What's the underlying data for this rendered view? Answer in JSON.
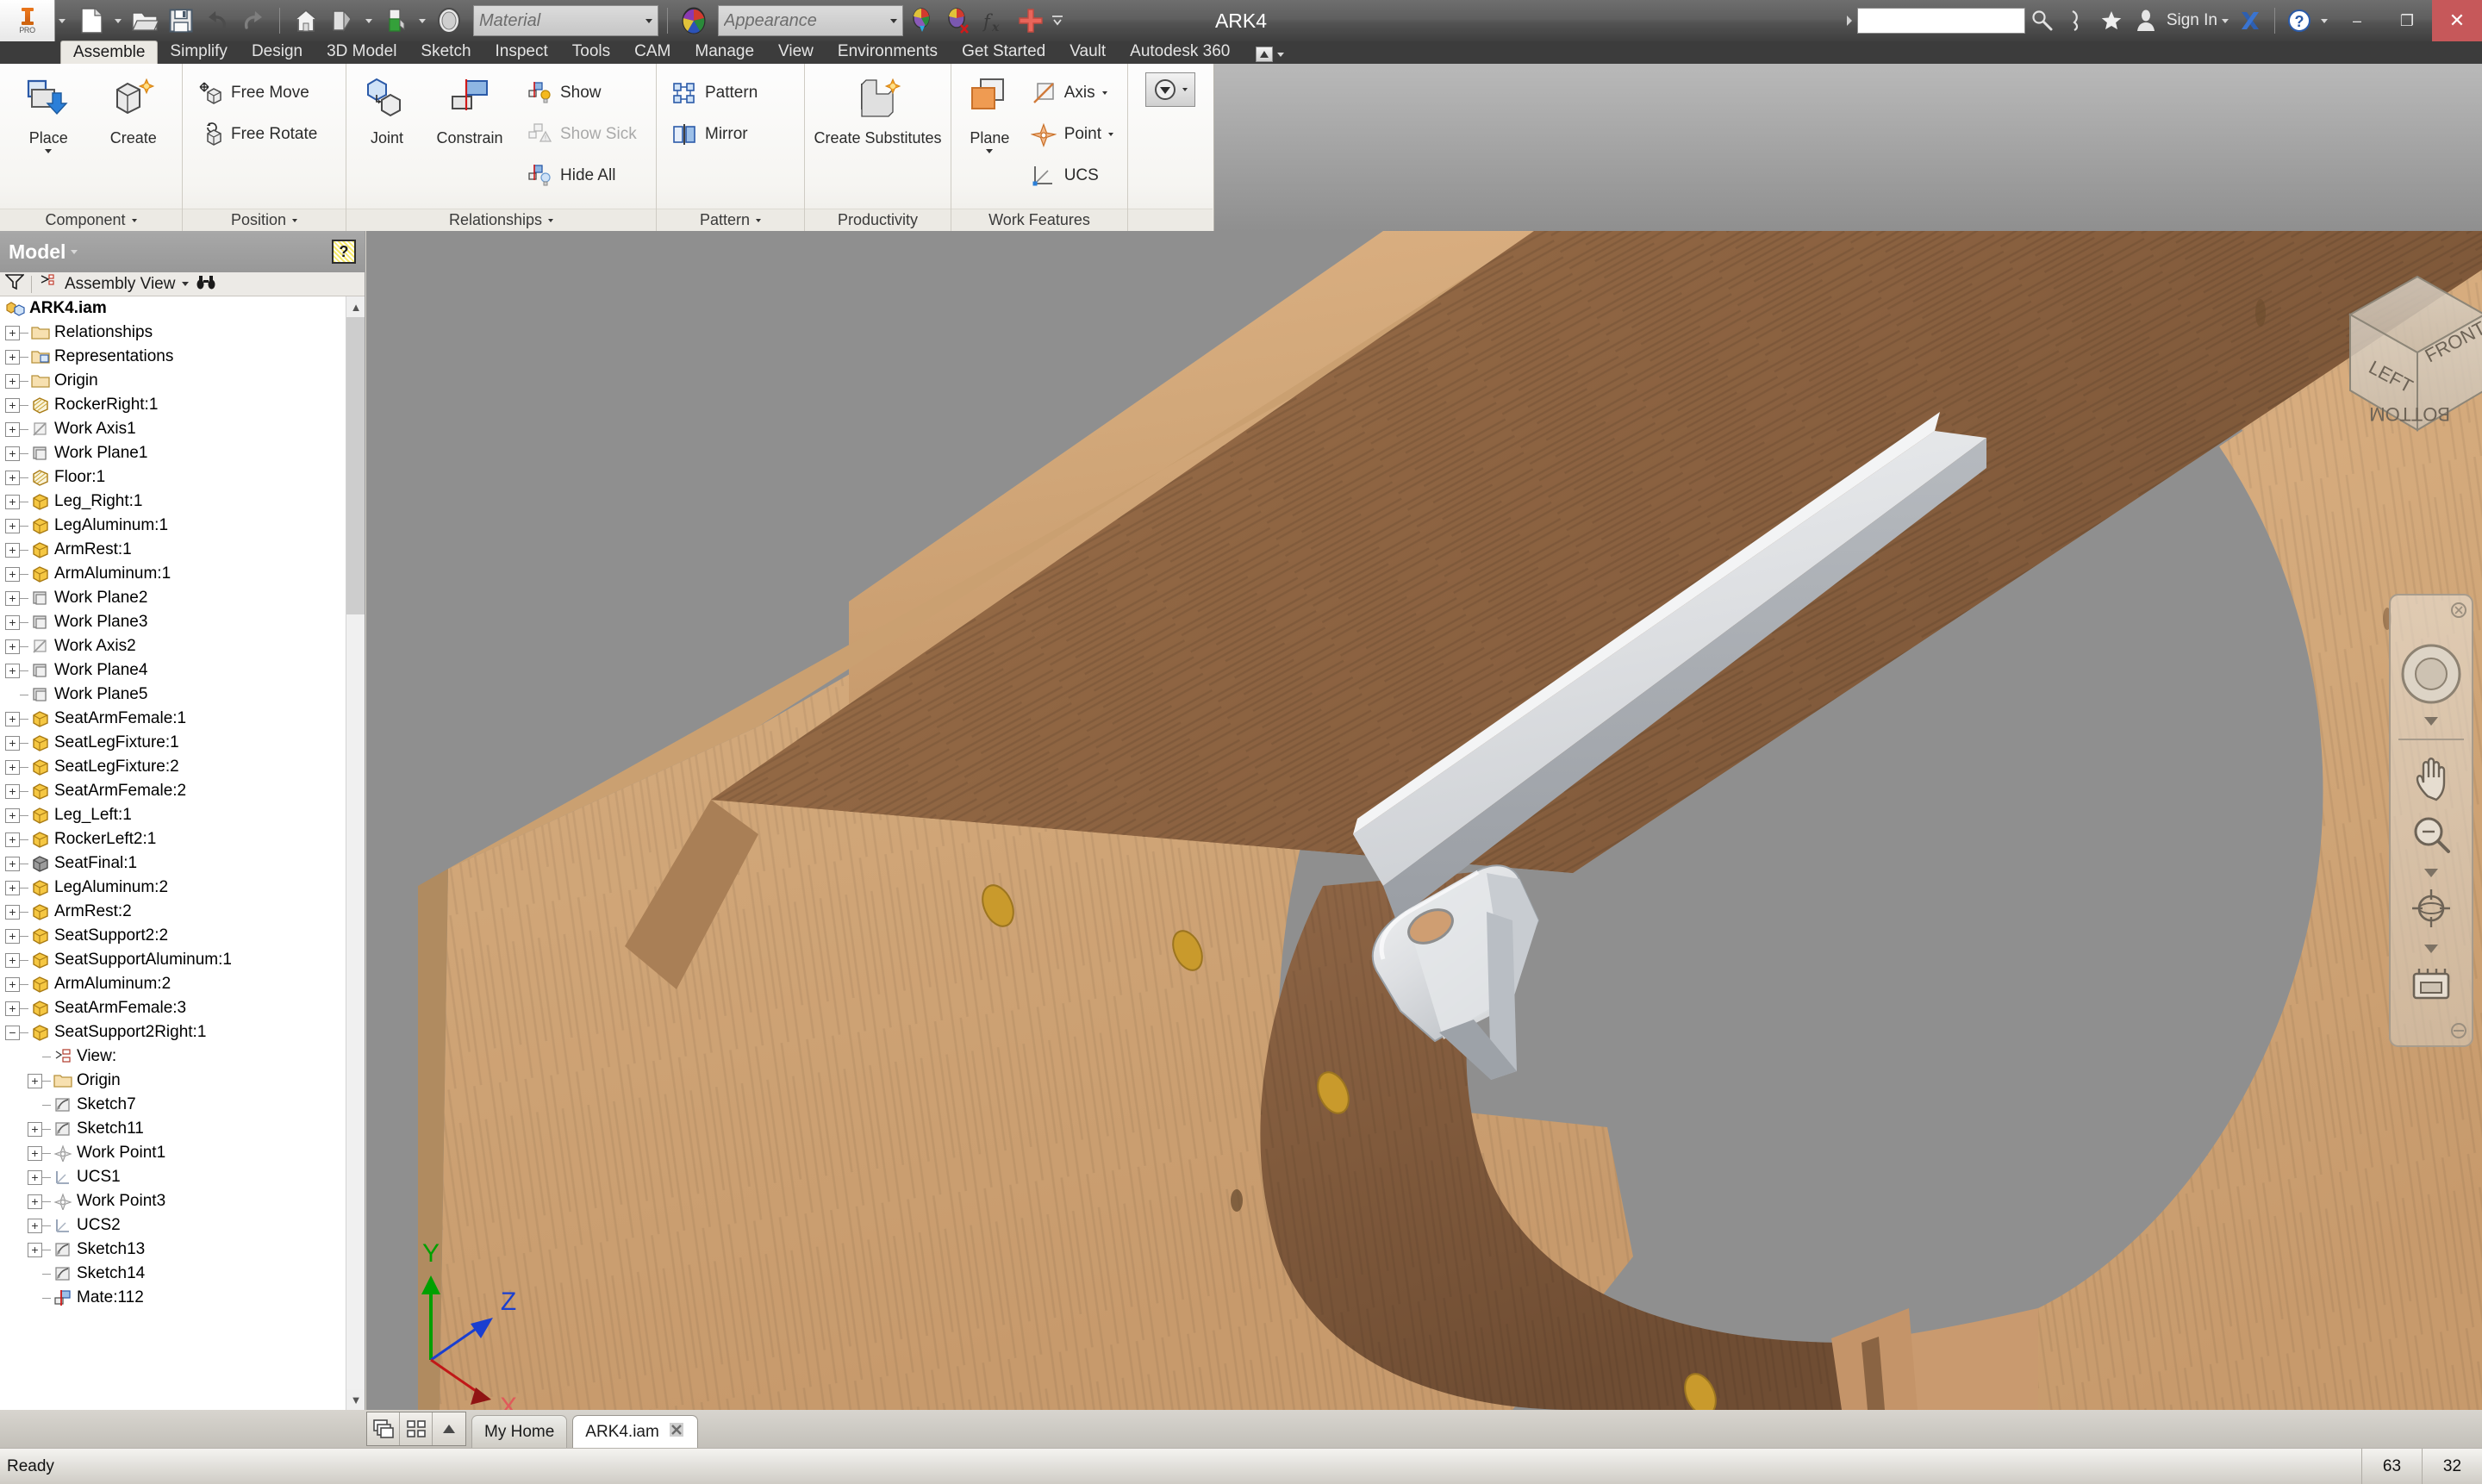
{
  "titlebar": {
    "app_name": "Inventor Professional",
    "pro_badge": "PRO",
    "document_title": "ARK4",
    "material_placeholder": "Material",
    "appearance_placeholder": "Appearance",
    "search_value": "",
    "sign_in_label": "Sign In",
    "minimize_label": "–",
    "restore_label": "❐",
    "close_label": "✕",
    "quick_access": [
      {
        "name": "new-file-icon",
        "label": "New"
      },
      {
        "name": "open-file-icon",
        "label": "Open"
      },
      {
        "name": "save-icon",
        "label": "Save"
      },
      {
        "name": "undo-icon",
        "label": "Undo"
      },
      {
        "name": "redo-icon",
        "label": "Redo"
      },
      {
        "name": "home-icon",
        "label": "Home"
      },
      {
        "name": "appearance-override-icon",
        "label": "Appearance Override"
      },
      {
        "name": "material-swatch-icon",
        "label": "Material"
      },
      {
        "name": "clear-appearance-icon",
        "label": "Clear Appearance"
      },
      {
        "name": "parameters-fx-icon",
        "label": "fx"
      },
      {
        "name": "add-parameter-icon",
        "label": "Add"
      }
    ]
  },
  "ribbon_tabs": [
    {
      "label": "Assemble",
      "active": true
    },
    {
      "label": "Simplify",
      "active": false
    },
    {
      "label": "Design",
      "active": false
    },
    {
      "label": "3D Model",
      "active": false
    },
    {
      "label": "Sketch",
      "active": false
    },
    {
      "label": "Inspect",
      "active": false
    },
    {
      "label": "Tools",
      "active": false
    },
    {
      "label": "CAM",
      "active": false
    },
    {
      "label": "Manage",
      "active": false
    },
    {
      "label": "View",
      "active": false
    },
    {
      "label": "Environments",
      "active": false
    },
    {
      "label": "Get Started",
      "active": false
    },
    {
      "label": "Vault",
      "active": false
    },
    {
      "label": "Autodesk 360",
      "active": false
    }
  ],
  "ribbon_panels": [
    {
      "title": "Component",
      "big_buttons": [
        {
          "label": "Place",
          "icon": "place-component-icon",
          "dropdown": true
        },
        {
          "label": "Create",
          "icon": "create-component-icon",
          "dropdown": false
        }
      ],
      "small_buttons": []
    },
    {
      "title": "Position",
      "big_buttons": [],
      "small_buttons": [
        {
          "label": "Free Move",
          "icon": "free-move-icon",
          "disabled": false
        },
        {
          "label": "Free Rotate",
          "icon": "free-rotate-icon",
          "disabled": false
        }
      ]
    },
    {
      "title": "Relationships",
      "big_buttons": [
        {
          "label": "Joint",
          "icon": "joint-icon",
          "dropdown": false
        },
        {
          "label": "Constrain",
          "icon": "constrain-icon",
          "dropdown": false
        }
      ],
      "small_buttons": [
        {
          "label": "Show",
          "icon": "show-relationships-icon",
          "disabled": false
        },
        {
          "label": "Show Sick",
          "icon": "show-sick-icon",
          "disabled": true
        },
        {
          "label": "Hide All",
          "icon": "hide-all-icon",
          "disabled": false
        }
      ]
    },
    {
      "title": "Pattern",
      "big_buttons": [],
      "small_buttons": [
        {
          "label": "Pattern",
          "icon": "pattern-icon",
          "disabled": false
        },
        {
          "label": "Mirror",
          "icon": "mirror-icon",
          "disabled": false
        }
      ]
    },
    {
      "title": "Productivity",
      "big_buttons": [
        {
          "label": "Create Substitutes",
          "icon": "create-substitutes-icon",
          "dropdown": true
        }
      ],
      "small_buttons": []
    },
    {
      "title": "Work Features",
      "big_buttons": [
        {
          "label": "Plane",
          "icon": "work-plane-icon",
          "dropdown": true
        }
      ],
      "small_buttons": [
        {
          "label": "Axis",
          "icon": "work-axis-icon",
          "disabled": false,
          "dropdown": true
        },
        {
          "label": "Point",
          "icon": "work-point-icon",
          "disabled": false,
          "dropdown": true
        },
        {
          "label": "UCS",
          "icon": "ucs-icon",
          "disabled": false,
          "dropdown": false
        }
      ]
    },
    {
      "title": "",
      "big_buttons": [],
      "small_buttons": [
        {
          "label": "",
          "icon": "bom-dropdown-icon",
          "disabled": false,
          "dropdown": true
        }
      ]
    }
  ],
  "browser": {
    "panel_title": "Model",
    "help_icon": "help-icon",
    "filter_icon": "filter-icon",
    "view_mode": "Assembly View",
    "find_icon": "binoculars-icon",
    "tree": [
      {
        "label": "ARK4.iam",
        "depth": 0,
        "icon": "assembly-icon",
        "expander": "none",
        "root": true
      },
      {
        "label": "Relationships",
        "depth": 1,
        "icon": "folder-icon",
        "expander": "plus"
      },
      {
        "label": "Representations",
        "depth": 1,
        "icon": "representations-icon",
        "expander": "plus"
      },
      {
        "label": "Origin",
        "depth": 1,
        "icon": "folder-icon",
        "expander": "plus"
      },
      {
        "label": "RockerRight:1",
        "depth": 1,
        "icon": "part-shaded-icon",
        "expander": "plus"
      },
      {
        "label": "Work Axis1",
        "depth": 1,
        "icon": "work-axis-tree-icon",
        "expander": "plus"
      },
      {
        "label": "Work Plane1",
        "depth": 1,
        "icon": "work-plane-tree-icon",
        "expander": "plus"
      },
      {
        "label": "Floor:1",
        "depth": 1,
        "icon": "part-shaded-icon",
        "expander": "plus"
      },
      {
        "label": "Leg_Right:1",
        "depth": 1,
        "icon": "part-icon",
        "expander": "plus"
      },
      {
        "label": "LegAluminum:1",
        "depth": 1,
        "icon": "part-icon",
        "expander": "plus"
      },
      {
        "label": "ArmRest:1",
        "depth": 1,
        "icon": "part-icon",
        "expander": "plus"
      },
      {
        "label": "ArmAluminum:1",
        "depth": 1,
        "icon": "part-icon",
        "expander": "plus"
      },
      {
        "label": "Work Plane2",
        "depth": 1,
        "icon": "work-plane-tree-icon",
        "expander": "plus"
      },
      {
        "label": "Work Plane3",
        "depth": 1,
        "icon": "work-plane-tree-icon",
        "expander": "plus"
      },
      {
        "label": "Work Axis2",
        "depth": 1,
        "icon": "work-axis-tree-icon",
        "expander": "plus"
      },
      {
        "label": "Work Plane4",
        "depth": 1,
        "icon": "work-plane-tree-icon",
        "expander": "plus"
      },
      {
        "label": "Work Plane5",
        "depth": 1,
        "icon": "work-plane-tree-icon",
        "expander": "none"
      },
      {
        "label": "SeatArmFemale:1",
        "depth": 1,
        "icon": "part-icon",
        "expander": "plus"
      },
      {
        "label": "SeatLegFixture:1",
        "depth": 1,
        "icon": "part-icon",
        "expander": "plus"
      },
      {
        "label": "SeatLegFixture:2",
        "depth": 1,
        "icon": "part-icon",
        "expander": "plus"
      },
      {
        "label": "SeatArmFemale:2",
        "depth": 1,
        "icon": "part-icon",
        "expander": "plus"
      },
      {
        "label": "Leg_Left:1",
        "depth": 1,
        "icon": "part-icon",
        "expander": "plus"
      },
      {
        "label": "RockerLeft2:1",
        "depth": 1,
        "icon": "part-icon",
        "expander": "plus"
      },
      {
        "label": "SeatFinal:1",
        "depth": 1,
        "icon": "part-grey-icon",
        "expander": "plus"
      },
      {
        "label": "LegAluminum:2",
        "depth": 1,
        "icon": "part-icon",
        "expander": "plus"
      },
      {
        "label": "ArmRest:2",
        "depth": 1,
        "icon": "part-icon",
        "expander": "plus"
      },
      {
        "label": "SeatSupport2:2",
        "depth": 1,
        "icon": "part-icon",
        "expander": "plus"
      },
      {
        "label": "SeatSupportAluminum:1",
        "depth": 1,
        "icon": "part-icon",
        "expander": "plus"
      },
      {
        "label": "ArmAluminum:2",
        "depth": 1,
        "icon": "part-icon",
        "expander": "plus"
      },
      {
        "label": "SeatArmFemale:3",
        "depth": 1,
        "icon": "part-icon",
        "expander": "plus"
      },
      {
        "label": "SeatSupport2Right:1",
        "depth": 1,
        "icon": "part-icon",
        "expander": "minus"
      },
      {
        "label": "View:",
        "depth": 2,
        "icon": "view-rep-icon",
        "expander": "none"
      },
      {
        "label": "Origin",
        "depth": 2,
        "icon": "folder-icon",
        "expander": "plus"
      },
      {
        "label": "Sketch7",
        "depth": 2,
        "icon": "sketch-icon",
        "expander": "none"
      },
      {
        "label": "Sketch11",
        "depth": 2,
        "icon": "sketch-icon",
        "expander": "plus"
      },
      {
        "label": "Work Point1",
        "depth": 2,
        "icon": "work-point-tree-icon",
        "expander": "plus"
      },
      {
        "label": "UCS1",
        "depth": 2,
        "icon": "ucs-tree-icon",
        "expander": "plus"
      },
      {
        "label": "Work Point3",
        "depth": 2,
        "icon": "work-point-tree-icon",
        "expander": "plus"
      },
      {
        "label": "UCS2",
        "depth": 2,
        "icon": "ucs-tree-icon",
        "expander": "plus"
      },
      {
        "label": "Sketch13",
        "depth": 2,
        "icon": "sketch-icon",
        "expander": "plus"
      },
      {
        "label": "Sketch14",
        "depth": 2,
        "icon": "sketch-icon",
        "expander": "none"
      },
      {
        "label": "Mate:112",
        "depth": 2,
        "icon": "mate-icon",
        "expander": "none"
      }
    ]
  },
  "viewport": {
    "background_color": "#8f8f8f",
    "view_cube": {
      "faces": [
        "LEFT",
        "FRONT",
        "BOTTOM"
      ]
    },
    "nav_bar": [
      {
        "name": "steering-wheel-icon"
      },
      {
        "name": "pan-icon"
      },
      {
        "name": "zoom-icon"
      },
      {
        "name": "orbit-icon"
      },
      {
        "name": "look-at-icon"
      }
    ],
    "axis_triad": {
      "x_label": "X",
      "y_label": "Y",
      "z_label": "Z",
      "x_color": "#c01818",
      "y_color": "#00a000",
      "z_color": "#1a3fd0"
    },
    "scene_colors": {
      "wood_light": "#d2a778",
      "wood_dark": "#8b6242",
      "aluminum": "#d9dadd",
      "aluminum_shadow": "#8f9398",
      "dowel": "#c99a2c"
    }
  },
  "docbar": {
    "buttons": [
      {
        "name": "cascade-windows-icon"
      },
      {
        "name": "tile-windows-icon"
      },
      {
        "name": "scroll-tabs-up-icon"
      }
    ],
    "tabs": [
      {
        "label": "My Home",
        "active": false,
        "closeable": false
      },
      {
        "label": "ARK4.iam",
        "active": true,
        "closeable": true,
        "close_icon": "close-tab-icon"
      }
    ]
  },
  "statusbar": {
    "message": "Ready",
    "cells": [
      "63",
      "32"
    ]
  }
}
